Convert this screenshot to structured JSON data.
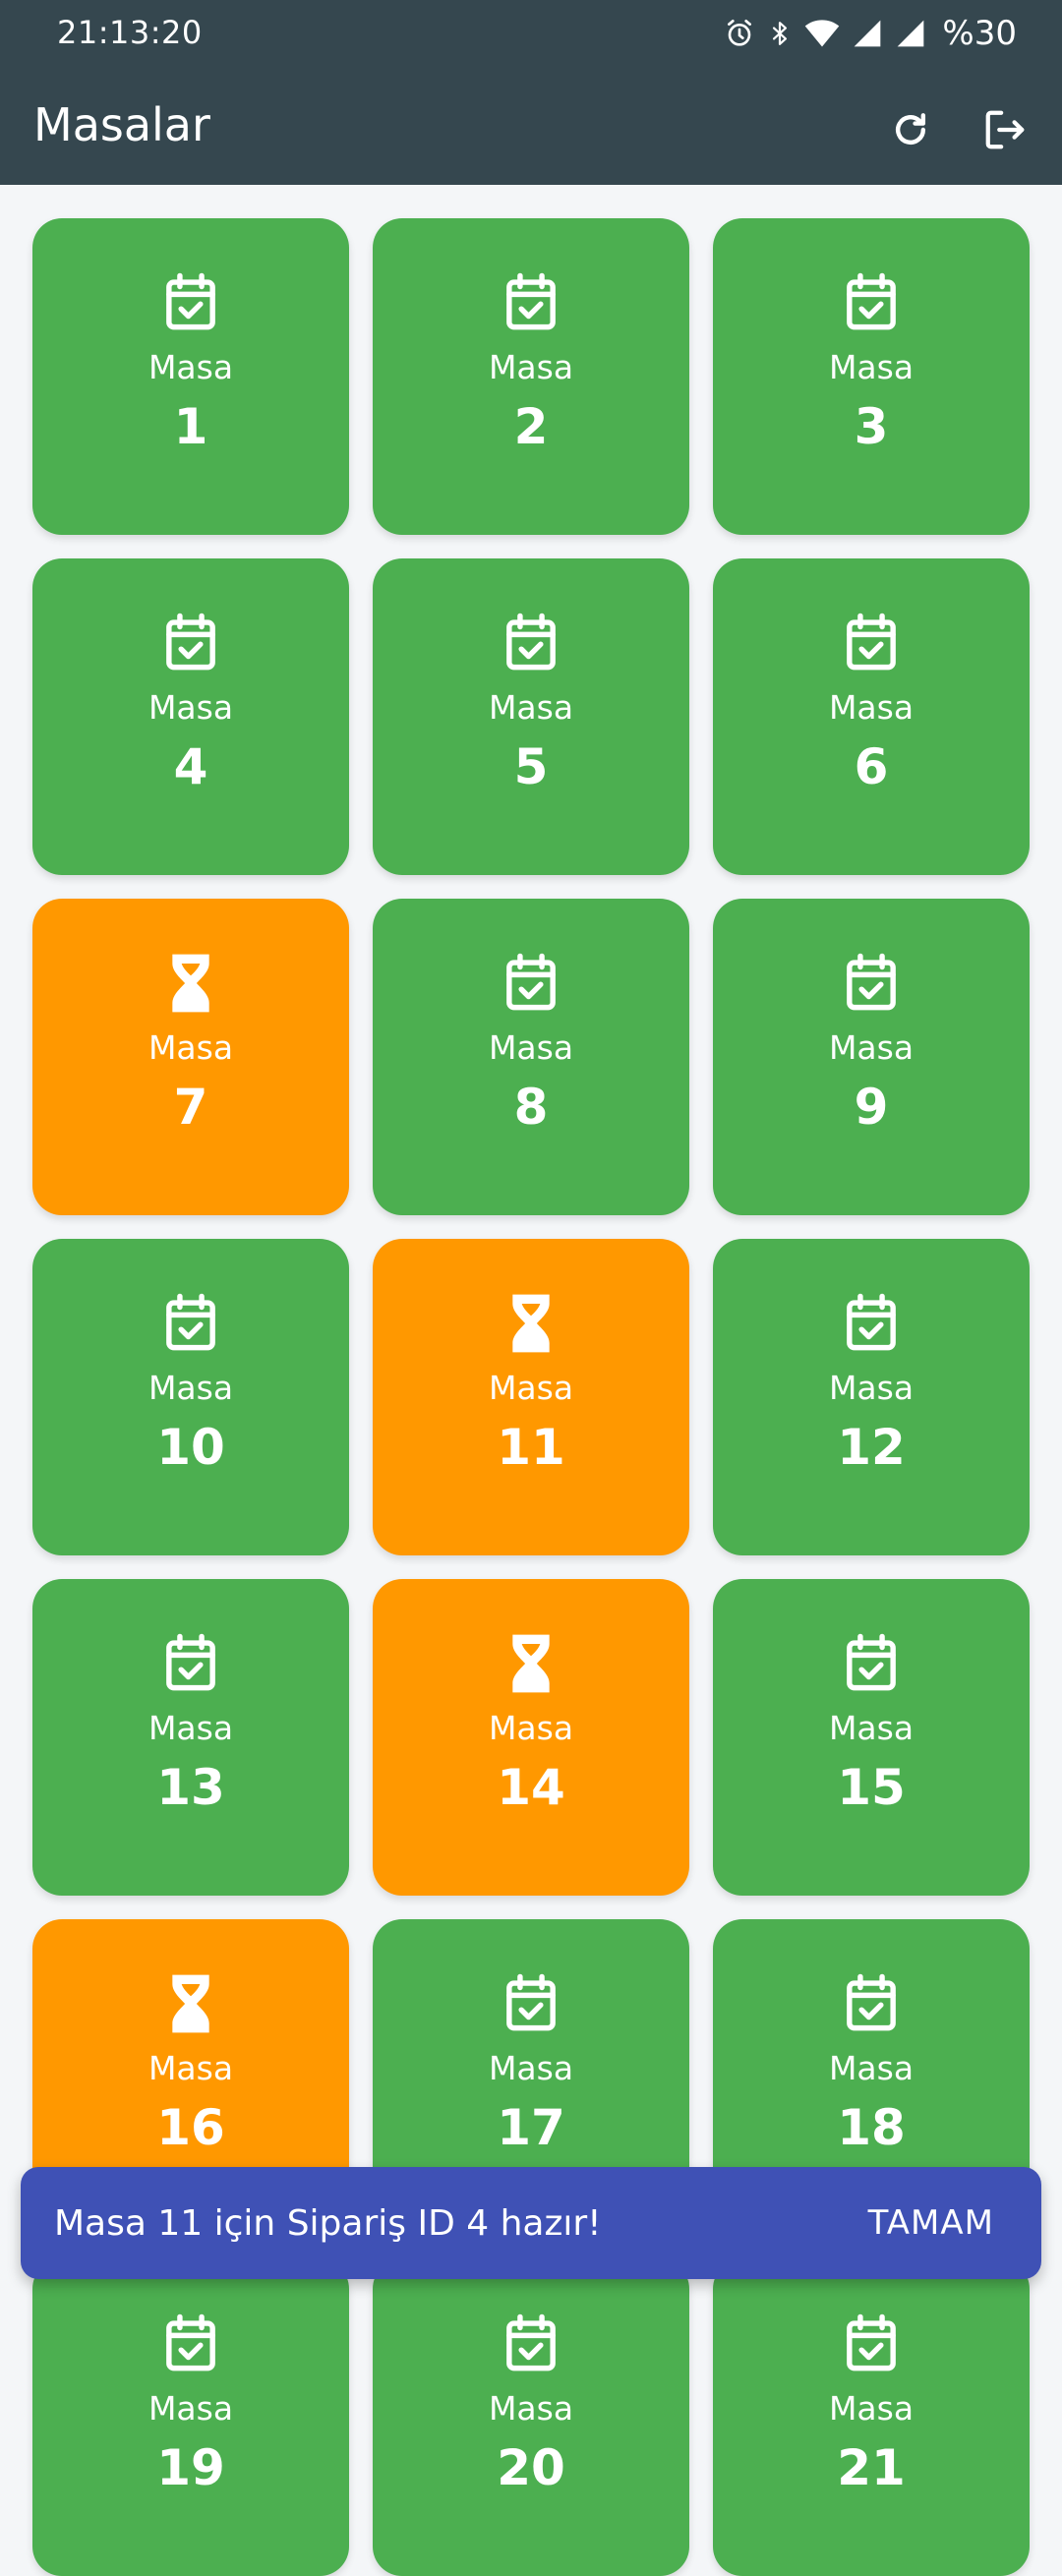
{
  "status_bar": {
    "time": "21:13:20",
    "battery": "%30",
    "icons": [
      "alarm-icon",
      "bluetooth-icon",
      "wifi-icon",
      "signal-icon",
      "signal-icon"
    ]
  },
  "app_bar": {
    "title": "Masalar",
    "actions": [
      "refresh-icon",
      "logout-icon"
    ]
  },
  "colors": {
    "app_bar": "#35474f",
    "available": "#4caf50",
    "pending": "#ff9800",
    "snackbar": "#3f51b5"
  },
  "tables": [
    {
      "label": "Masa",
      "number": "1",
      "status": "available",
      "icon": "calendar-check-icon"
    },
    {
      "label": "Masa",
      "number": "2",
      "status": "available",
      "icon": "calendar-check-icon"
    },
    {
      "label": "Masa",
      "number": "3",
      "status": "available",
      "icon": "calendar-check-icon"
    },
    {
      "label": "Masa",
      "number": "4",
      "status": "available",
      "icon": "calendar-check-icon"
    },
    {
      "label": "Masa",
      "number": "5",
      "status": "available",
      "icon": "calendar-check-icon"
    },
    {
      "label": "Masa",
      "number": "6",
      "status": "available",
      "icon": "calendar-check-icon"
    },
    {
      "label": "Masa",
      "number": "7",
      "status": "pending",
      "icon": "hourglass-icon"
    },
    {
      "label": "Masa",
      "number": "8",
      "status": "available",
      "icon": "calendar-check-icon"
    },
    {
      "label": "Masa",
      "number": "9",
      "status": "available",
      "icon": "calendar-check-icon"
    },
    {
      "label": "Masa",
      "number": "10",
      "status": "available",
      "icon": "calendar-check-icon"
    },
    {
      "label": "Masa",
      "number": "11",
      "status": "pending",
      "icon": "hourglass-icon"
    },
    {
      "label": "Masa",
      "number": "12",
      "status": "available",
      "icon": "calendar-check-icon"
    },
    {
      "label": "Masa",
      "number": "13",
      "status": "available",
      "icon": "calendar-check-icon"
    },
    {
      "label": "Masa",
      "number": "14",
      "status": "pending",
      "icon": "hourglass-icon"
    },
    {
      "label": "Masa",
      "number": "15",
      "status": "available",
      "icon": "calendar-check-icon"
    },
    {
      "label": "Masa",
      "number": "16",
      "status": "pending",
      "icon": "hourglass-icon"
    },
    {
      "label": "Masa",
      "number": "17",
      "status": "available",
      "icon": "calendar-check-icon"
    },
    {
      "label": "Masa",
      "number": "18",
      "status": "available",
      "icon": "calendar-check-icon"
    },
    {
      "label": "Masa",
      "number": "19",
      "status": "available",
      "icon": "calendar-check-icon"
    },
    {
      "label": "Masa",
      "number": "20",
      "status": "available",
      "icon": "calendar-check-icon"
    },
    {
      "label": "Masa",
      "number": "21",
      "status": "available",
      "icon": "calendar-check-icon"
    }
  ],
  "snackbar": {
    "message": "Masa 11 için Sipariş ID 4 hazır!",
    "action": "TAMAM"
  }
}
